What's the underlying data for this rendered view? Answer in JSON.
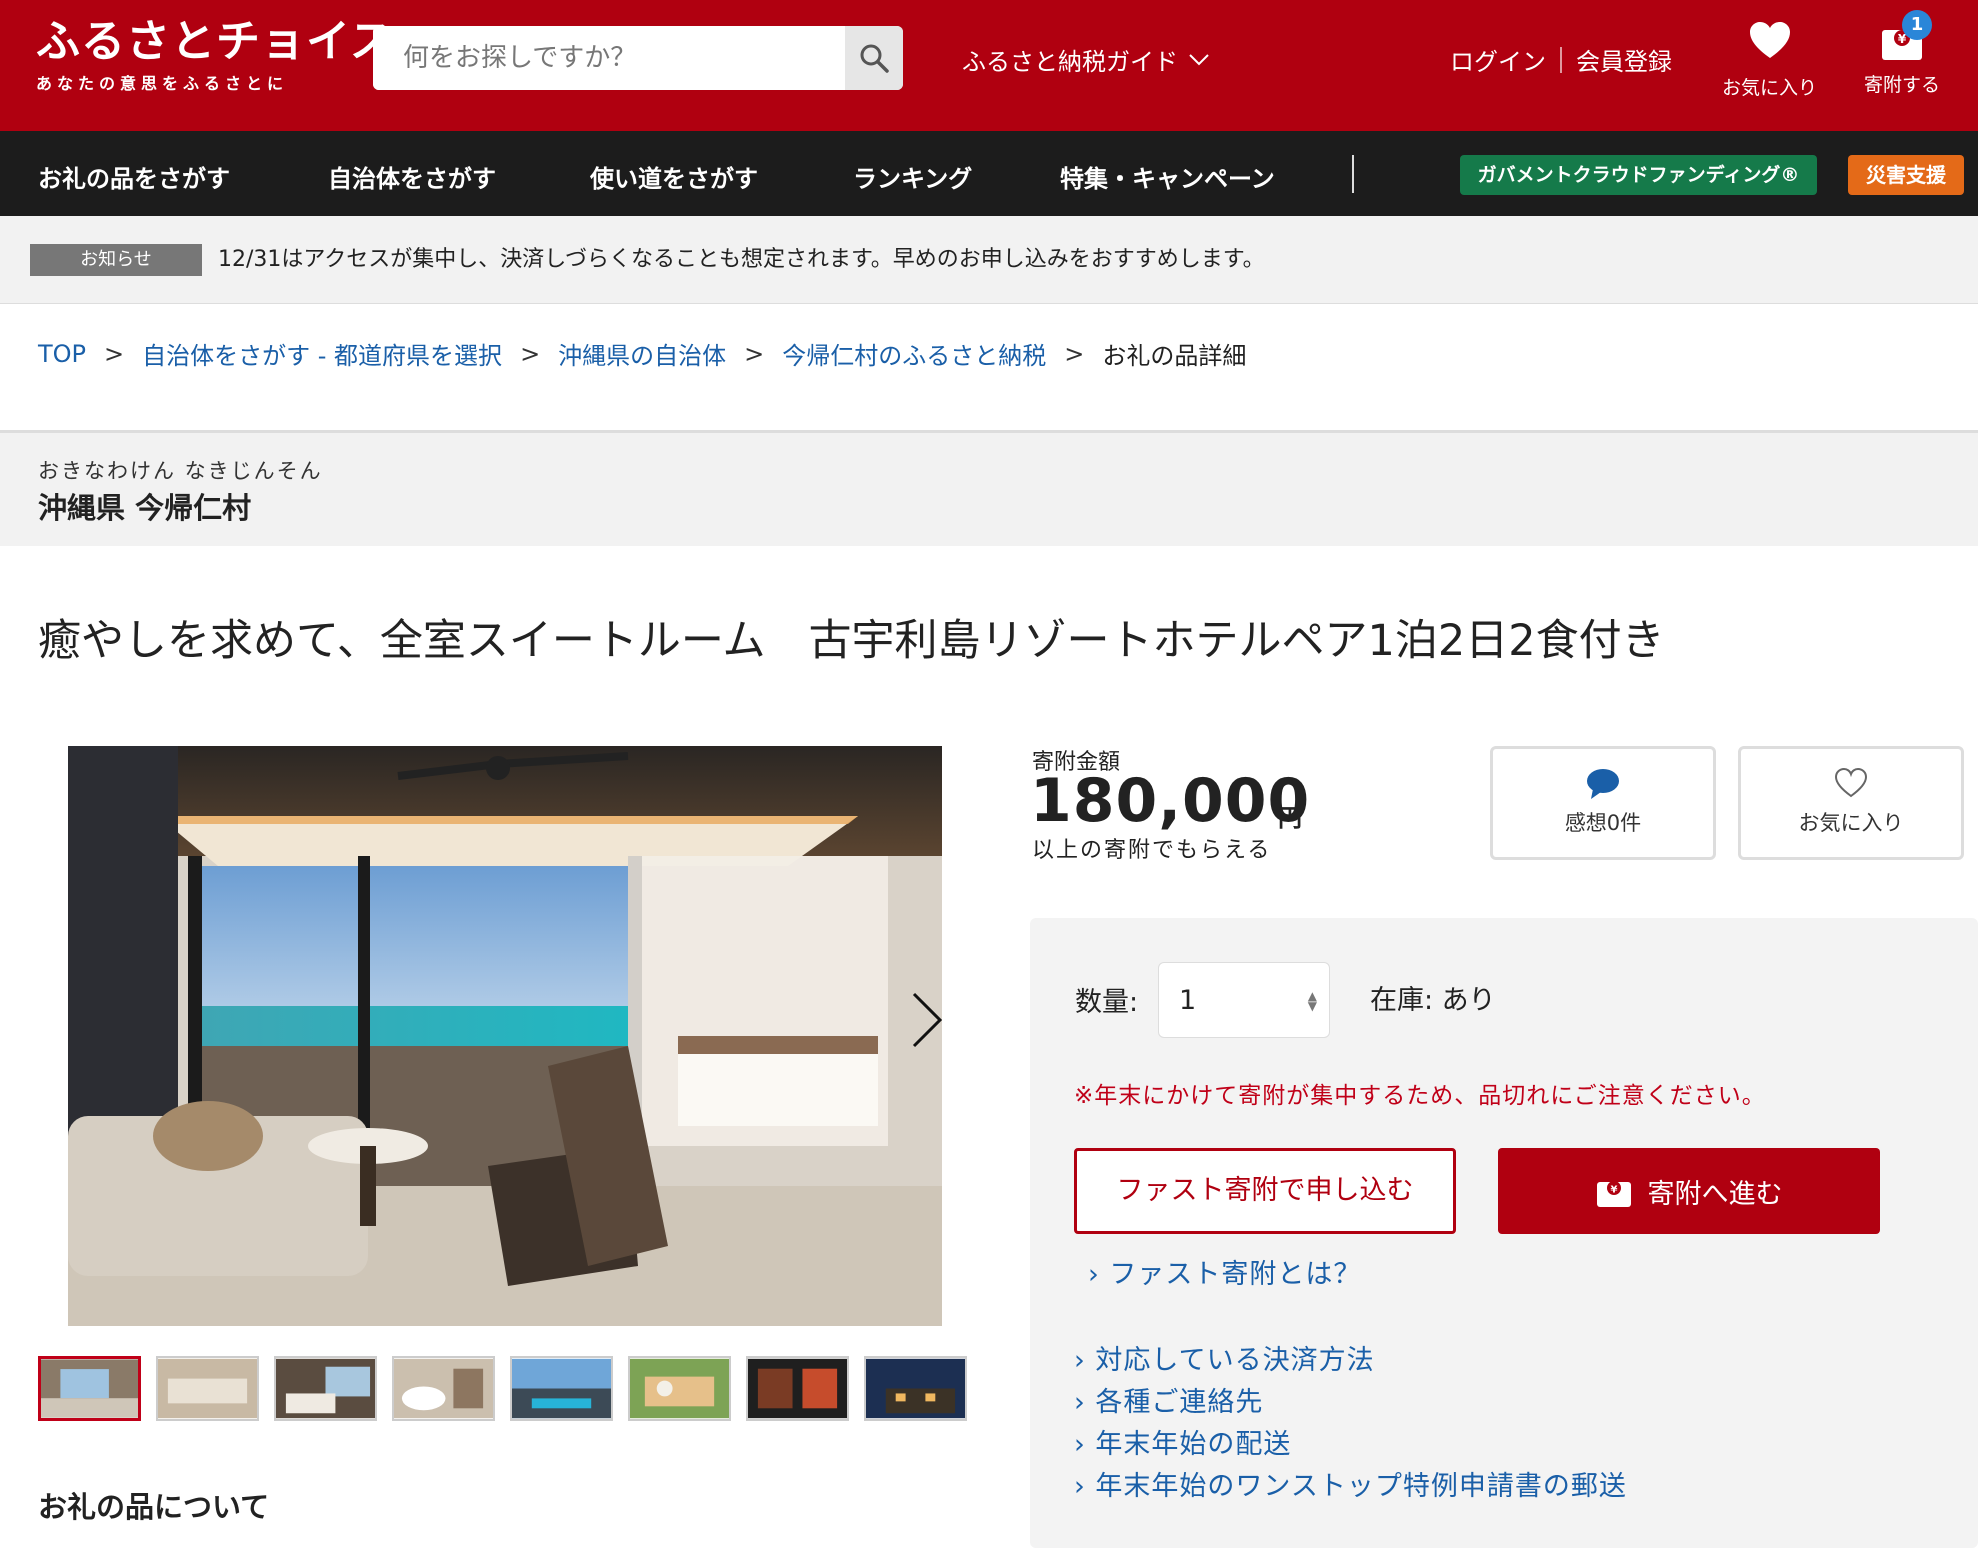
{
  "header": {
    "logo": "ふるさとチョイス",
    "tagline": "あなたの意思をふるさとに",
    "search_placeholder": "何をお探しですか？",
    "guide_label": "ふるさと納税ガイド",
    "login_label": "ログイン",
    "register_label": "会員登録",
    "favorites_label": "お気に入り",
    "donate_label": "寄附する",
    "cart_count": "1"
  },
  "nav": {
    "items": [
      "お礼の品をさがす",
      "自治体をさがす",
      "使い道をさがす",
      "ランキング",
      "特集・キャンペーン"
    ],
    "gcf_label": "ガバメントクラウドファンディング®",
    "disaster_label": "災害支援"
  },
  "notice": {
    "tag": "お知らせ",
    "text": "12/31はアクセスが集中し、決済しづらくなることも想定されます。早めのお申し込みをおすすめします。"
  },
  "breadcrumb": {
    "items": [
      "TOP",
      "自治体をさがす - 都道府県を選択",
      "沖縄県の自治体",
      "今帰仁村のふるさと納税"
    ],
    "current": "お礼の品詳細"
  },
  "municipality": {
    "kana": "おきなわけん なきじんそん",
    "name": "沖縄県 今帰仁村"
  },
  "product": {
    "title": "癒やしを求めて、全室スイートルーム　古宇利島リゾートホテルペア1泊2日2食付き",
    "about_heading": "お礼の品について"
  },
  "donation": {
    "amount_label": "寄附金額",
    "amount": "180,000",
    "currency": "円",
    "amount_note": "以上の寄附でもらえる",
    "review_label": "感想0件",
    "favorite_label": "お気に入り",
    "quantity_label": "数量:",
    "quantity_value": "1",
    "stock_label": "在庫: あり",
    "warning": "※年末にかけて寄附が集中するため、品切れにご注意ください。",
    "fast_button": "ファスト寄附で申し込む",
    "next_button": "寄附へ進む",
    "fast_link": "ファスト寄附とは？",
    "links": [
      "対応している決済方法",
      "各種ご連絡先",
      "年末年始の配送",
      "年末年始のワンストップ特例申請書の郵送"
    ]
  },
  "colors": {
    "brand_red": "#b00010",
    "nav_dark": "#1c1c1c",
    "link_blue": "#1a5fa8",
    "gcf_green": "#157a4a",
    "disaster_orange": "#e46a18"
  }
}
